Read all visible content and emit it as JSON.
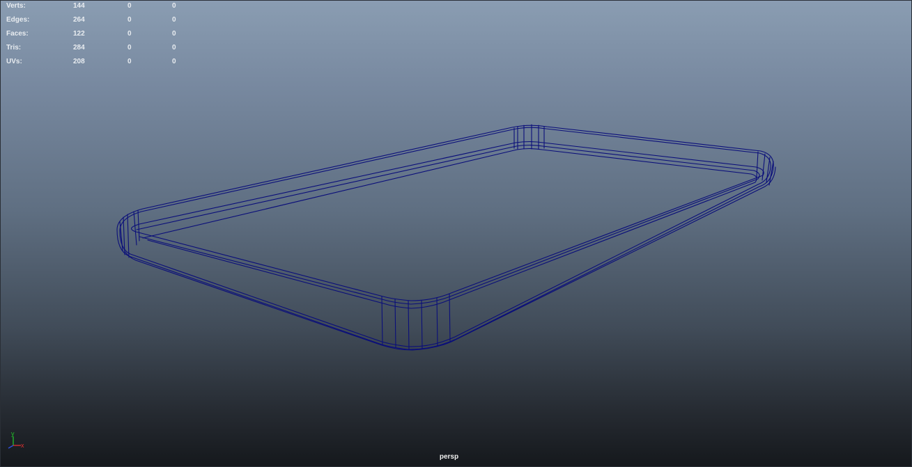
{
  "hud": {
    "rows": [
      {
        "label": "Verts:",
        "values": [
          "144",
          "0",
          "0"
        ]
      },
      {
        "label": "Edges:",
        "values": [
          "264",
          "0",
          "0"
        ]
      },
      {
        "label": "Faces:",
        "values": [
          "122",
          "0",
          "0"
        ]
      },
      {
        "label": "Tris:",
        "values": [
          "284",
          "0",
          "0"
        ]
      },
      {
        "label": "UVs:",
        "values": [
          "208",
          "0",
          "0"
        ]
      }
    ]
  },
  "camera": {
    "name": "persp"
  },
  "axis_gizmo": {
    "y_label": "y",
    "x_label": "x",
    "y_color": "#22c12a",
    "x_color": "#e03030",
    "z_color": "#3050e0"
  },
  "colors": {
    "wireframe": "#0a0e7a",
    "hud_text": "#e8ecf0"
  },
  "mesh": {
    "description_shape": "rounded-tray",
    "display_mode": "wireframe"
  }
}
